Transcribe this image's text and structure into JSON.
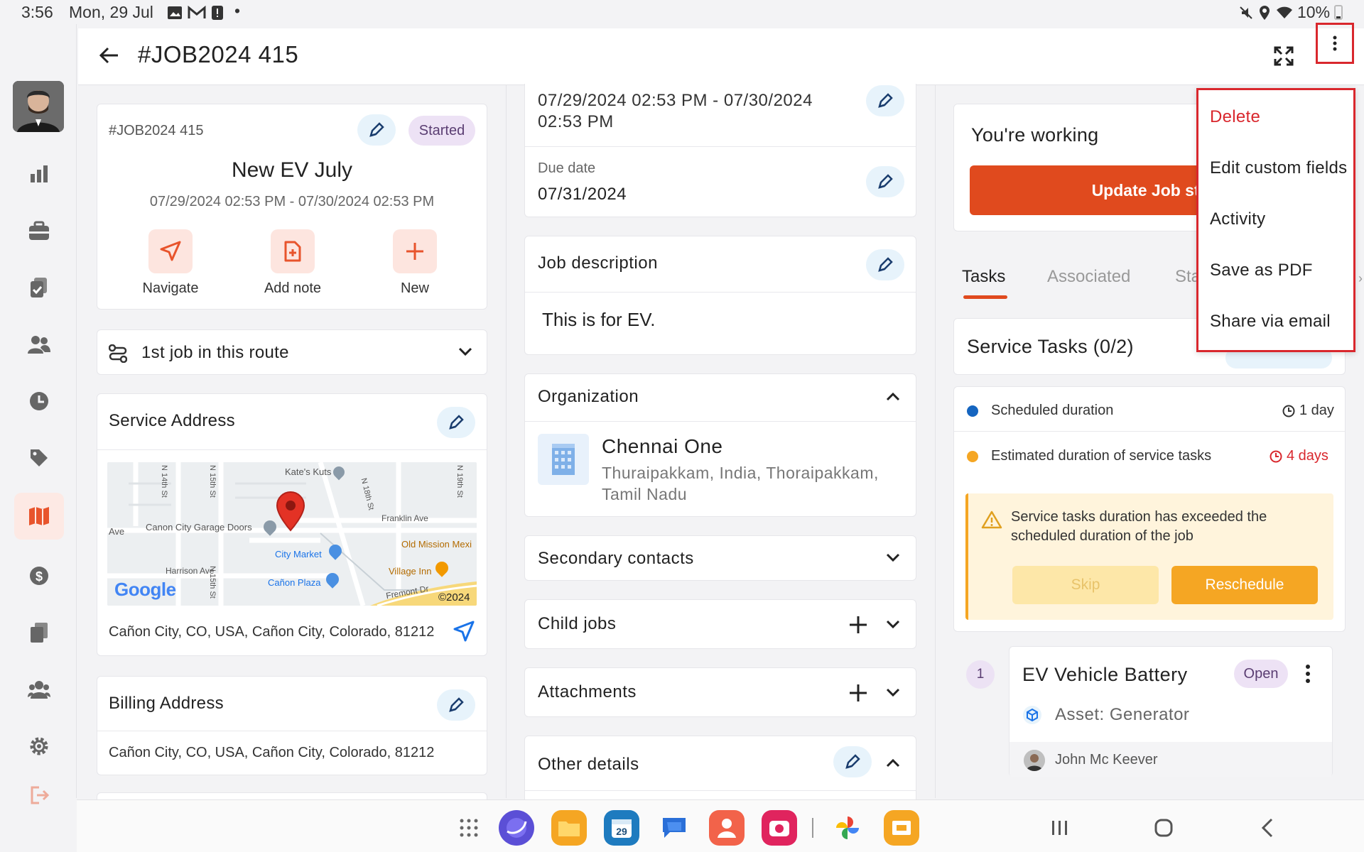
{
  "status_bar": {
    "time": "3:56",
    "date": "Mon, 29 Jul",
    "battery": "10%",
    "dot": "•"
  },
  "header": {
    "job_title": "#JOB2024 415"
  },
  "job_card": {
    "number": "#JOB2024 415",
    "status": "Started",
    "name": "New EV July",
    "schedule": "07/29/2024 02:53 PM - 07/30/2024 02:53 PM",
    "actions": [
      {
        "label": "Navigate",
        "icon": "navigate-icon"
      },
      {
        "label": "Add note",
        "icon": "add-note-icon"
      },
      {
        "label": "New",
        "icon": "plus-icon"
      }
    ]
  },
  "route": {
    "label": "1st job in this route"
  },
  "service_address": {
    "title": "Service Address",
    "address": "Cañon City, CO, USA, Cañon City, Colorado, 81212"
  },
  "map": {
    "labels": {
      "kates": "Kate's Kuts",
      "canon": "Canon City Garage Doors",
      "franklin": "Franklin Ave",
      "citymarket": "City Market",
      "oldmission": "Old Mission Mexi",
      "harrison": "Harrison Ave",
      "canonplaza": "Cañon Plaza",
      "village": "Village Inn",
      "fremont": "Fremont Dr",
      "copyright": "©2024",
      "ave": "Ave",
      "n14": "N 14th St",
      "n15": "N 15th St",
      "n15b": "N 15th St",
      "n18": "N 18th St",
      "n19": "N 19th St",
      "google": "Google"
    }
  },
  "billing_address": {
    "title": "Billing Address",
    "address": "Cañon City, CO, USA, Cañon City, Colorado, 81212"
  },
  "middle": {
    "schedule_line1": "07/29/2024 02:53 PM - 07/30/2024",
    "schedule_line2": "02:53 PM",
    "due_label": "Due date",
    "due_value": "07/31/2024",
    "job_desc_title": "Job description",
    "job_desc_text": "This is for EV.",
    "org_title": "Organization",
    "org_name": "Chennai One",
    "org_address": "Thuraipakkam, India, Thoraipakkam, Tamil Nadu",
    "secondary_contacts": "Secondary contacts",
    "child_jobs": "Child jobs",
    "attachments": "Attachments",
    "other_details": "Other details"
  },
  "right": {
    "working_title": "You're working",
    "update_button": "Update Job sta",
    "tabs": [
      "Tasks",
      "Associated",
      "Sta"
    ],
    "service_tasks_title": "Service Tasks (0/2)",
    "scheduled_label": "Scheduled duration",
    "scheduled_value": "1 day",
    "estimated_label": "Estimated duration of service tasks",
    "estimated_value": "4 days",
    "warning_text": "Service tasks duration has exceeded the scheduled duration of the job",
    "skip": "Skip",
    "reschedule": "Reschedule",
    "task_index": "1",
    "task_name": "EV Vehicle Battery",
    "task_status": "Open",
    "task_asset": "Asset: Generator",
    "task_assignee": "John Mc Keever"
  },
  "menu": {
    "items": [
      "Delete",
      "Edit custom fields",
      "Activity",
      "Save as PDF",
      "Share via email"
    ]
  },
  "colors": {
    "accent": "#e8542c",
    "danger": "#d9272d",
    "blue_dot": "#1565c0",
    "orange_dot": "#f5a623",
    "warning_bg": "#fff4dc",
    "reschedule": "#f5a623"
  }
}
